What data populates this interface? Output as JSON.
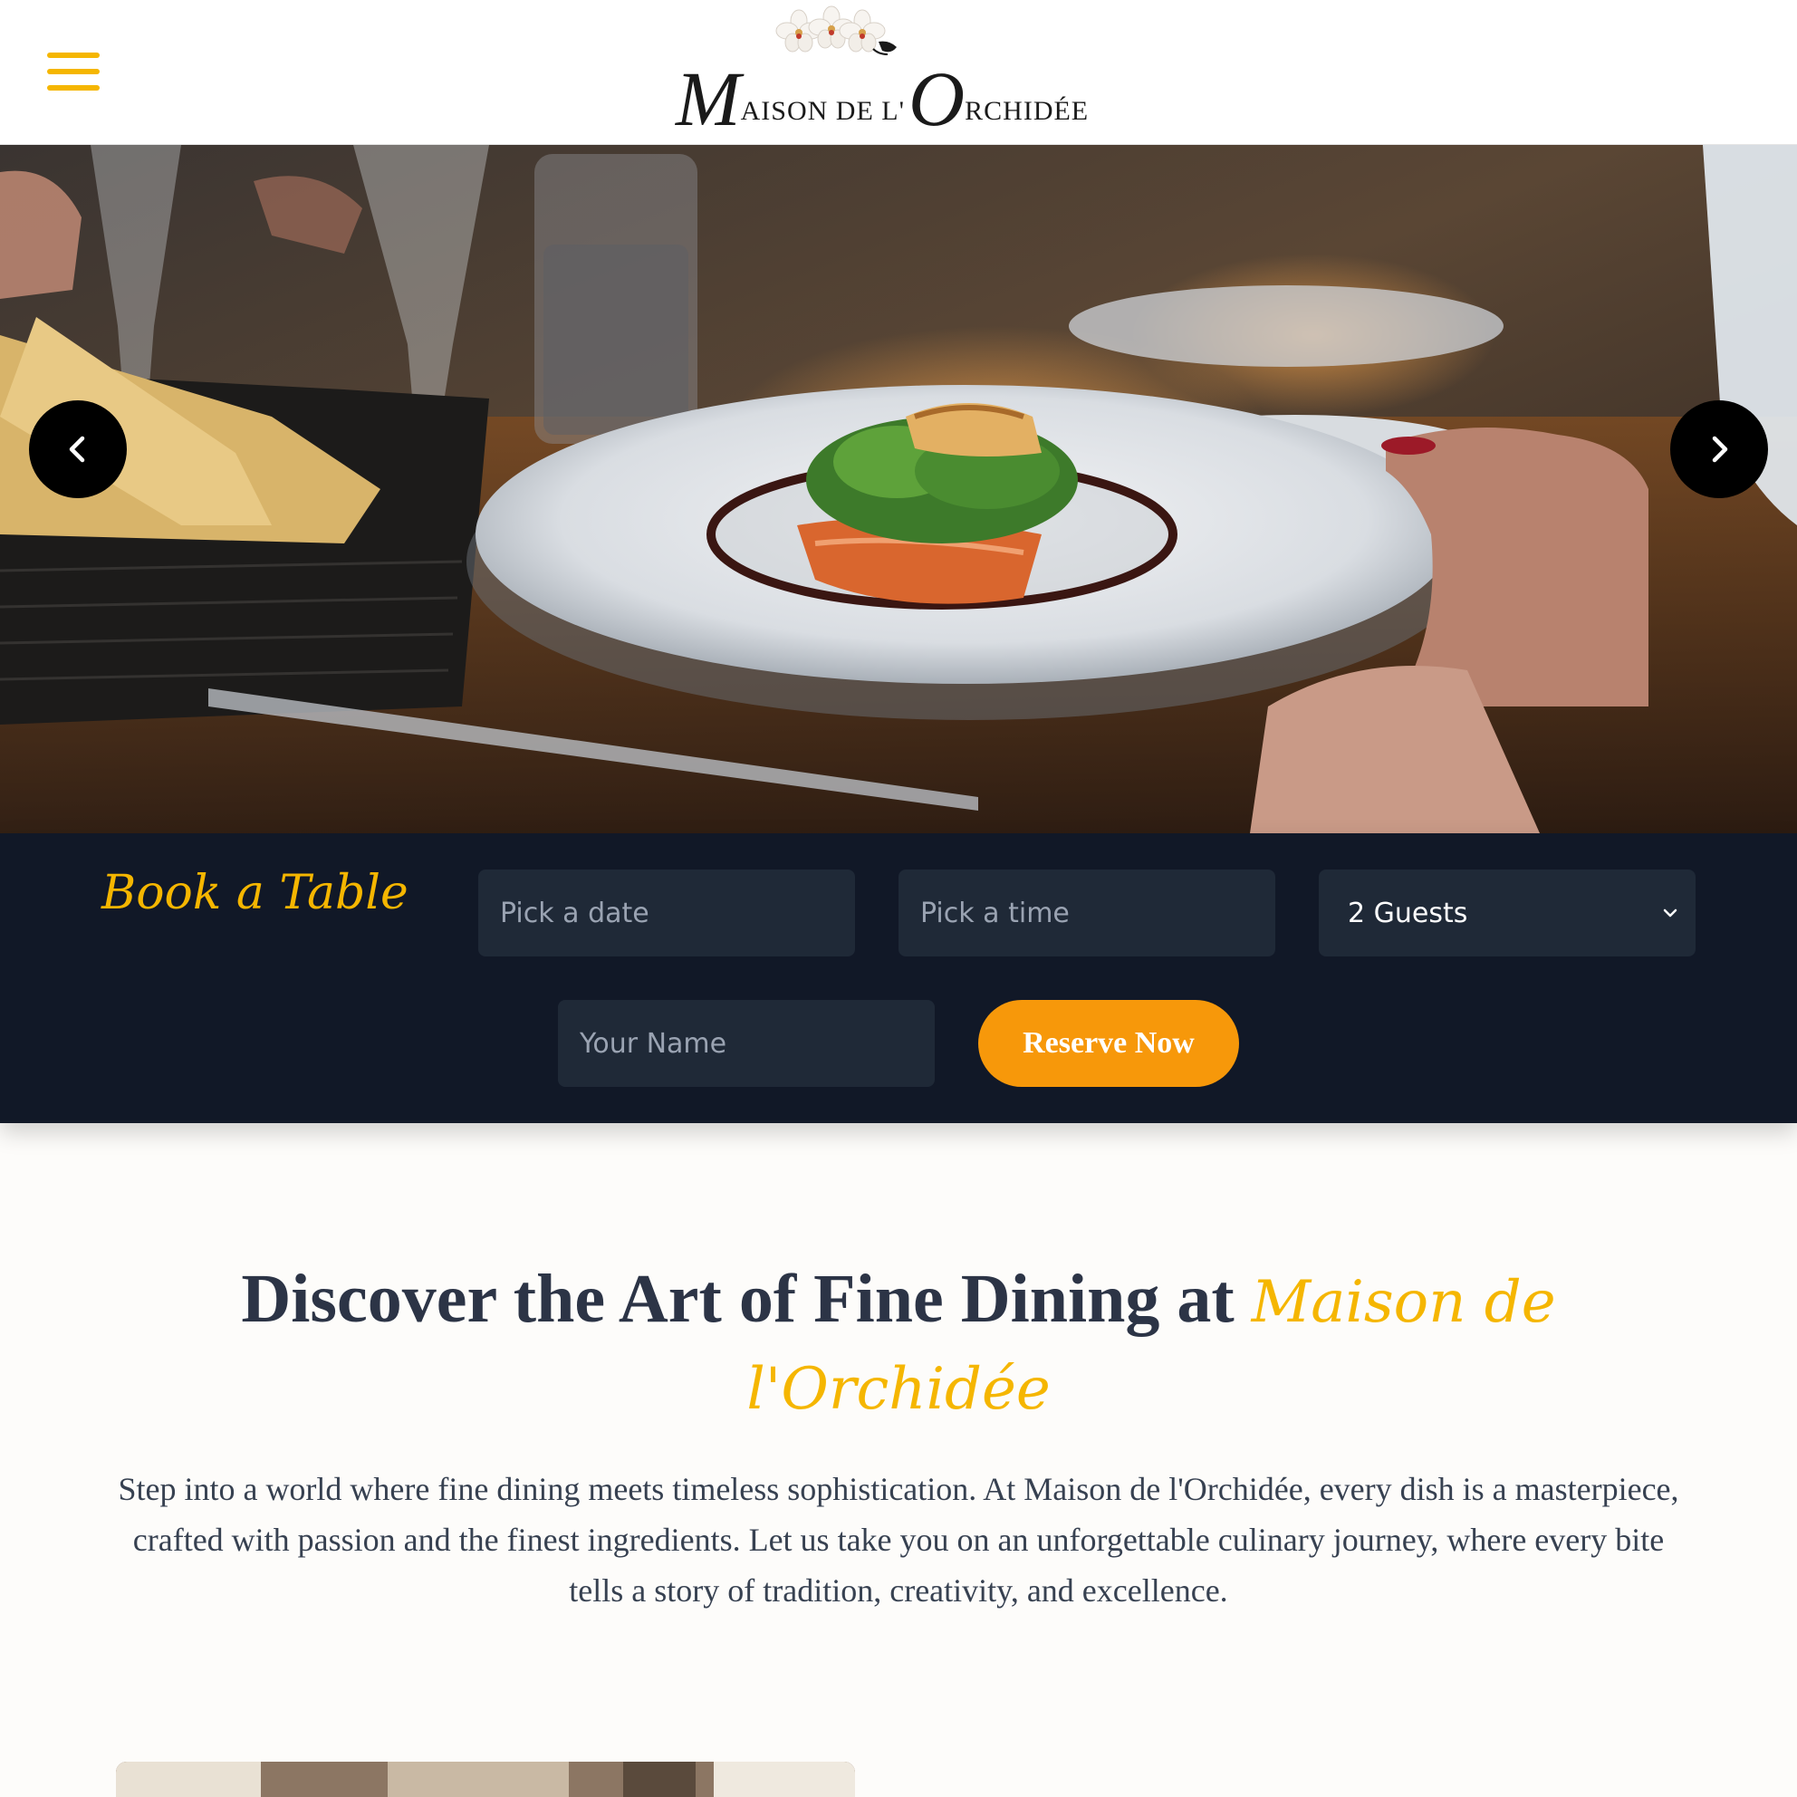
{
  "header": {
    "menu_icon": "hamburger-menu-icon",
    "logo": {
      "name": "Maison de l'Orchidée",
      "cap_m": "M",
      "word1": "AISON DE L'",
      "cap_o": "O",
      "word2": "RCHIDÉE",
      "flower_icon": "orchid-flowers-icon"
    }
  },
  "hero": {
    "image": "plated-dish-restaurant-photo",
    "prev_icon": "chevron-left-icon",
    "next_icon": "chevron-right-icon"
  },
  "booking": {
    "title": "Book a Table",
    "date_placeholder": "Pick a date",
    "time_placeholder": "Pick a time",
    "guests_value": "2 Guests",
    "name_placeholder": "Your Name",
    "reserve_label": "Reserve Now"
  },
  "intro": {
    "title_main": "Discover the Art of Fine Dining at ",
    "title_accent": "Maison de l'Orchidée",
    "paragraph": "Step into a world where fine dining meets timeless sophistication. At Maison de l'Orchidée, every dish is a masterpiece, crafted with passion and the finest ingredients. Let us take you on an unforgettable culinary journey, where every bite tells a story of tradition, creativity, and excellence."
  },
  "colors": {
    "accent": "#f5b600",
    "button": "#f7980a",
    "booking_bg": "#111827",
    "field_bg": "#1f2937",
    "heading": "#2c3446"
  }
}
